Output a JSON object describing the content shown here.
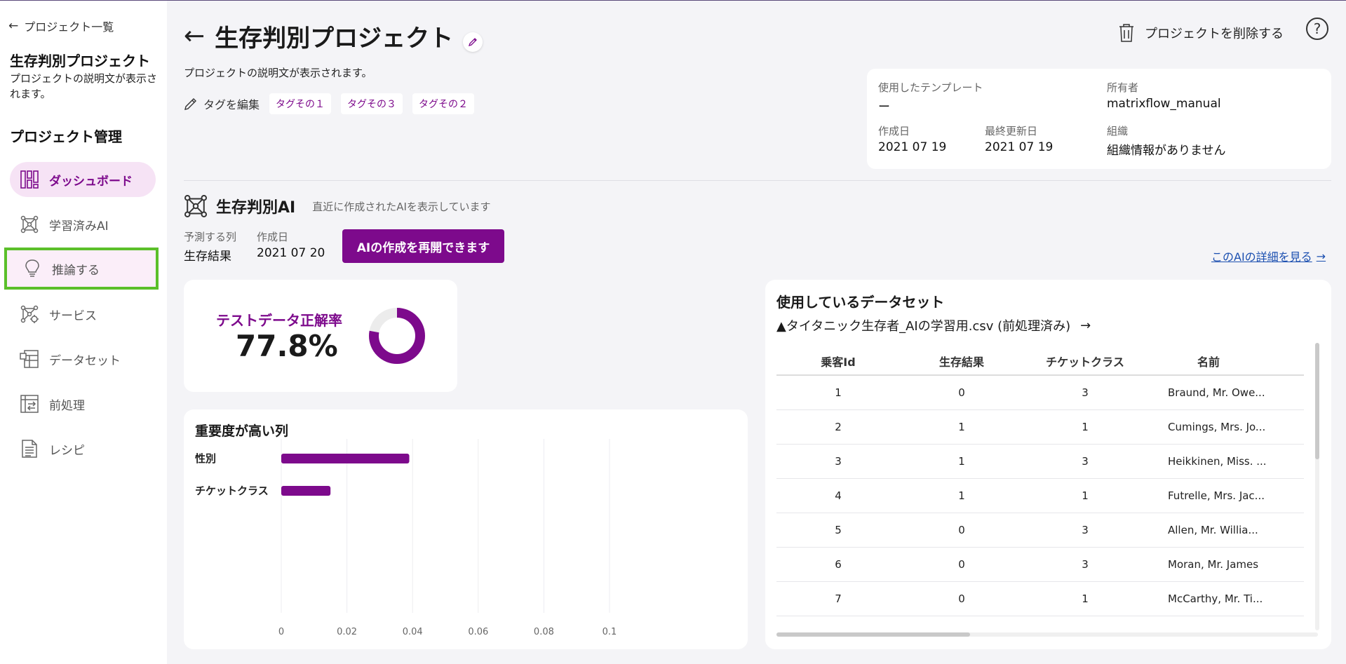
{
  "sidebar": {
    "back_label": "プロジェクト一覧",
    "project_title": "生存判別プロジェクト",
    "project_desc": "プロジェクトの説明文が表示されます。",
    "section_title": "プロジェクト管理",
    "items": [
      {
        "label": "ダッシュボード",
        "icon": "dashboard-icon",
        "active": true
      },
      {
        "label": "学習済みAI",
        "icon": "network-icon"
      },
      {
        "label": "推論する",
        "icon": "lightbulb-icon",
        "highlighted": true
      },
      {
        "label": "サービス",
        "icon": "service-icon"
      },
      {
        "label": "データセット",
        "icon": "dataset-icon"
      },
      {
        "label": "前処理",
        "icon": "preprocess-icon"
      },
      {
        "label": "レシピ",
        "icon": "recipe-icon"
      }
    ]
  },
  "header": {
    "title": "生存判別プロジェクト",
    "description": "プロジェクトの説明文が表示されます。",
    "tag_edit_label": "タグを編集",
    "tags": [
      "タグその１",
      "タグその３",
      "タグその２"
    ],
    "delete_label": "プロジェクトを削除する",
    "help_label": "?"
  },
  "meta": {
    "template_label": "使用したテンプレート",
    "template_value": "ー",
    "owner_label": "所有者",
    "owner_value": "matrixflow_manual",
    "created_label": "作成日",
    "created_value": "2021 07 19",
    "updated_label": "最終更新日",
    "updated_value": "2021 07 19",
    "org_label": "組織",
    "org_value": "組織情報がありません"
  },
  "ai": {
    "title": "生存判別AI",
    "note": "直近に作成されたAIを表示しています",
    "target_label": "予測する列",
    "target_value": "生存結果",
    "created_label": "作成日",
    "created_value": "2021 07 20",
    "resume_button": "AIの作成を再開できます",
    "detail_link": "このAIの詳細を見る"
  },
  "accuracy": {
    "label": "テストデータ正解率",
    "value_text": "77.8%",
    "value": 0.778,
    "color": "#7d0a8c"
  },
  "importance": {
    "title": "重要度が高い列"
  },
  "chart_data": {
    "type": "bar",
    "orientation": "horizontal",
    "title": "重要度が高い列",
    "categories": [
      "性別",
      "チケットクラス"
    ],
    "values": [
      0.039,
      0.015
    ],
    "xlim": [
      0,
      0.1
    ],
    "xticks": [
      "0",
      "0.02",
      "0.04",
      "0.06",
      "0.08",
      "0.1"
    ],
    "grid": true,
    "color": "#7d0a8c"
  },
  "dataset": {
    "title": "使用しているデータセット",
    "file": "▲タイタニック生存者_AIの学習用.csv (前処理済み)",
    "columns": [
      "乗客Id",
      "生存結果",
      "チケットクラス",
      "名前"
    ],
    "rows": [
      [
        "1",
        "0",
        "3",
        "Braund, Mr. Owe..."
      ],
      [
        "2",
        "1",
        "1",
        "Cumings, Mrs. Jo..."
      ],
      [
        "3",
        "1",
        "3",
        "Heikkinen, Miss. ..."
      ],
      [
        "4",
        "1",
        "1",
        "Futrelle, Mrs. Jac..."
      ],
      [
        "5",
        "0",
        "3",
        "Allen, Mr. Willia..."
      ],
      [
        "6",
        "0",
        "3",
        " Moran, Mr. James"
      ],
      [
        "7",
        "0",
        "1",
        "McCarthy, Mr. Ti..."
      ]
    ]
  },
  "colors": {
    "accent": "#7d0a8c",
    "highlight_border": "#5bbf2a",
    "link": "#1b4fb0"
  }
}
